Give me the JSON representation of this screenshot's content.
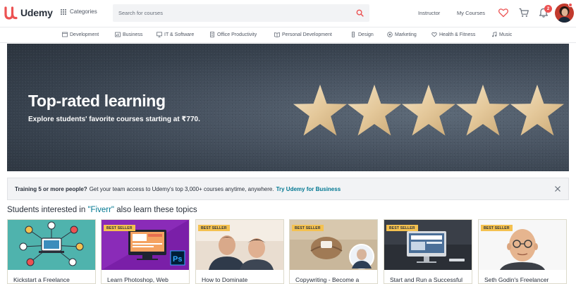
{
  "header": {
    "logo_text": "Udemy",
    "categories_label": "Categories",
    "search_placeholder": "Search for courses",
    "instructor_label": "Instructor",
    "my_courses_label": "My Courses",
    "notification_count": "2",
    "accent_color": "#ec5252"
  },
  "subnav": {
    "items": [
      {
        "label": "Development",
        "icon": "code-icon"
      },
      {
        "label": "Business",
        "icon": "chart-icon"
      },
      {
        "label": "IT & Software",
        "icon": "monitor-icon"
      },
      {
        "label": "Office Productivity",
        "icon": "document-icon"
      },
      {
        "label": "Personal Development",
        "icon": "book-icon"
      },
      {
        "label": "Design",
        "icon": "pen-icon"
      },
      {
        "label": "Marketing",
        "icon": "megaphone-icon"
      },
      {
        "label": "Health & Fitness",
        "icon": "heart-icon"
      },
      {
        "label": "Music",
        "icon": "music-icon"
      }
    ]
  },
  "hero": {
    "title": "Top-rated learning",
    "subtitle": "Explore students' favorite courses starting at ₹770."
  },
  "banner": {
    "lead": "Training 5 or more people?",
    "text": "Get your team access to Udemy's top 3,000+ courses anytime, anywhere.",
    "link": "Try Udemy for Business"
  },
  "section": {
    "prefix": "Students interested in ",
    "keyword": "\"Fiverr\"",
    "suffix": " also learn these topics"
  },
  "courses": [
    {
      "title": "Kickstart a Freelance",
      "bestseller": false
    },
    {
      "title": "Learn Photoshop, Web",
      "bestseller": true,
      "badge": "BEST SELLER"
    },
    {
      "title": "How to Dominate",
      "bestseller": true,
      "badge": "BEST SELLER"
    },
    {
      "title": "Copywriting - Become a",
      "bestseller": true,
      "badge": "BEST SELLER"
    },
    {
      "title": "Start and Run a Successful",
      "bestseller": true,
      "badge": "BEST SELLER"
    },
    {
      "title": "Seth Godin's Freelancer",
      "bestseller": true,
      "badge": "BEST SELLER"
    }
  ]
}
